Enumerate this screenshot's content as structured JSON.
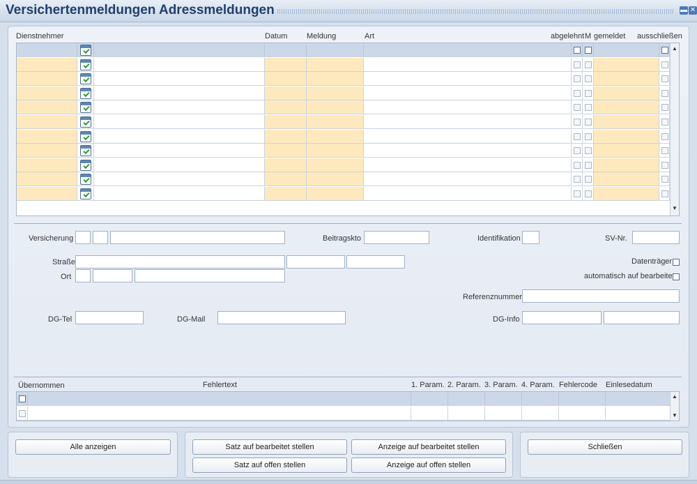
{
  "window": {
    "title": "Versichertenmeldungen Adressmeldungen",
    "minimize": "▬",
    "close": "✕"
  },
  "grid": {
    "headers": {
      "dienstnehmer": "Dienstnehmer",
      "datum": "Datum",
      "meldung": "Meldung",
      "art": "Art",
      "abgelehnt": "abgelehnt",
      "m": "M",
      "gemeldet": "gemeldet",
      "ausschliessen": "ausschließen"
    },
    "rows": 11
  },
  "form": {
    "versicherung": "Versicherung",
    "beitragskto": "Beitragskto",
    "identifikation": "Identifikation",
    "svnr": "SV-Nr.",
    "strasse": "Straße",
    "ort": "Ort",
    "datentraeger": "Datenträger",
    "automatisch": "automatisch auf bearbeitet",
    "referenznummer": "Referenznummer",
    "dgtel": "DG-Tel",
    "dgmail": "DG-Mail",
    "dginfo": "DG-Info"
  },
  "errors": {
    "headers": {
      "uebernommen": "Übernommen",
      "fehlertext": "Fehlertext",
      "p1": "1. Param.",
      "p2": "2. Param.",
      "p3": "3. Param.",
      "p4": "4. Param.",
      "fehlercode": "Fehlercode",
      "einlesedatum": "Einlesedatum"
    }
  },
  "buttons": {
    "alle_anzeigen": "Alle anzeigen",
    "satz_bearbeitet": "Satz auf bearbeitet stellen",
    "anzeige_bearbeitet": "Anzeige auf bearbeitet stellen",
    "satz_offen": "Satz auf offen stellen",
    "anzeige_offen": "Anzeige auf offen stellen",
    "schliessen": "Schließen"
  }
}
